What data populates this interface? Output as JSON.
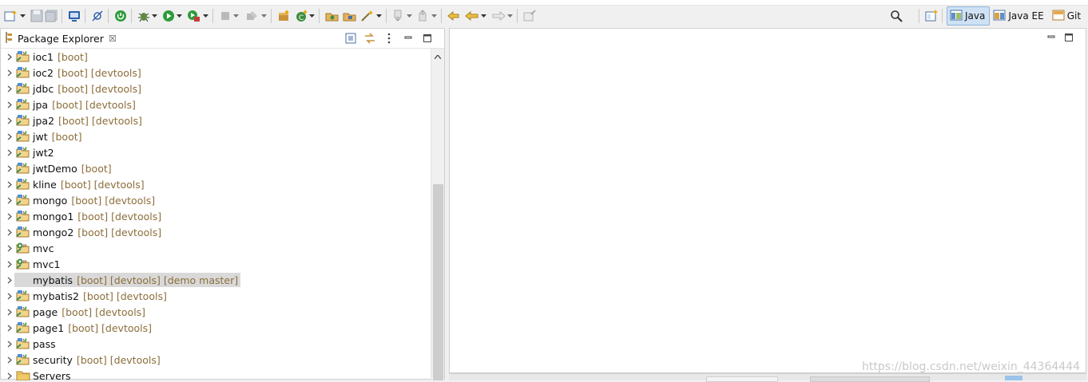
{
  "toolbar": {
    "perspectives": [
      {
        "label": "Java",
        "active": true
      },
      {
        "label": "Java EE",
        "active": false
      },
      {
        "label": "Git",
        "active": false
      }
    ]
  },
  "explorer": {
    "tab_title": "Package Explorer",
    "tab_close": "☒",
    "projects": [
      {
        "name": "ioc1",
        "decorations": "[boot]",
        "type": "boot"
      },
      {
        "name": "ioc2",
        "decorations": "[boot] [devtools]",
        "type": "boot"
      },
      {
        "name": "jdbc",
        "decorations": "[boot] [devtools]",
        "type": "boot"
      },
      {
        "name": "jpa",
        "decorations": "[boot] [devtools]",
        "type": "boot"
      },
      {
        "name": "jpa2",
        "decorations": "[boot] [devtools]",
        "type": "boot"
      },
      {
        "name": "jwt",
        "decorations": "[boot]",
        "type": "boot"
      },
      {
        "name": "jwt2",
        "decorations": "",
        "type": "boot"
      },
      {
        "name": "jwtDemo",
        "decorations": "[boot]",
        "type": "boot"
      },
      {
        "name": "kline",
        "decorations": "[boot] [devtools]",
        "type": "boot"
      },
      {
        "name": "mongo",
        "decorations": "[boot] [devtools]",
        "type": "boot"
      },
      {
        "name": "mongo1",
        "decorations": "[boot] [devtools]",
        "type": "boot"
      },
      {
        "name": "mongo2",
        "decorations": "[boot] [devtools]",
        "type": "boot"
      },
      {
        "name": "mvc",
        "decorations": "",
        "type": "maven"
      },
      {
        "name": "mvc1",
        "decorations": "",
        "type": "maven"
      },
      {
        "name": "mybatis",
        "decorations": "[boot] [devtools] [demo master]",
        "type": "git",
        "selected": true
      },
      {
        "name": "mybatis2",
        "decorations": "[boot] [devtools]",
        "type": "boot"
      },
      {
        "name": "page",
        "decorations": "[boot] [devtools]",
        "type": "boot"
      },
      {
        "name": "page1",
        "decorations": "[boot] [devtools]",
        "type": "boot"
      },
      {
        "name": "pass",
        "decorations": "",
        "type": "boot"
      },
      {
        "name": "security",
        "decorations": "[boot] [devtools]",
        "type": "boot"
      },
      {
        "name": "Servers",
        "decorations": "",
        "type": "folder"
      }
    ]
  },
  "watermark": "https://blog.csdn.net/weixin_44364444",
  "colors": {
    "decoration": "#8c6e3a",
    "selection": "#d9d9d9",
    "active_perspective": "#cfe2f5"
  }
}
